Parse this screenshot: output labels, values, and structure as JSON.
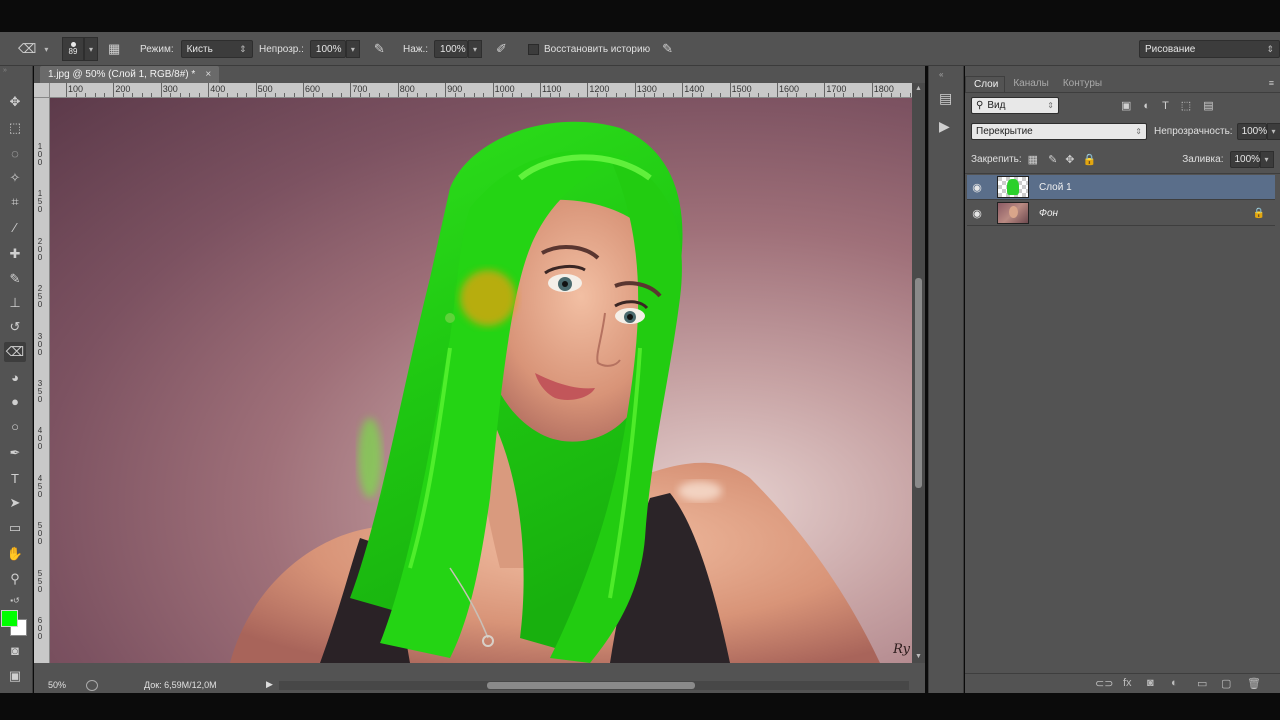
{
  "options_bar": {
    "brush_size": "89",
    "mode_label": "Режим:",
    "mode_value": "Кисть",
    "opacity_label": "Непрозр.:",
    "opacity_value": "100%",
    "pressure_label": "Наж.:",
    "pressure_value": "100%",
    "restore_history_label": "Восстановить историю",
    "workspace_value": "Рисование"
  },
  "document": {
    "tab_title": "1.jpg @ 50% (Слой 1, RGB/8#) *",
    "close_label": "×",
    "ruler_h": [
      "100",
      "200",
      "300",
      "400",
      "500",
      "600",
      "700",
      "800",
      "900",
      "1000",
      "1100",
      "1200",
      "1300",
      "1400",
      "1500",
      "1600",
      "1700",
      "1800"
    ],
    "ruler_v": [
      "1\n0\n0",
      "1\n5\n0",
      "2\n0\n0",
      "2\n5\n0",
      "3\n0\n0",
      "3\n5\n0",
      "4\n0\n0",
      "4\n5\n0",
      "5\n0\n0",
      "5\n5\n0",
      "6\n0\n0",
      "6\n5\n0"
    ],
    "zoom": "50%",
    "doc_info": "Док: 6,59M/12,0M",
    "signature": "Ry",
    "hair_color": "#22dd11",
    "hair_highlight": "#66ff33",
    "brush_spot_color": "#e8a010"
  },
  "toolbar": {
    "foreground_color": "#00ff00",
    "background_color": "#ffffff",
    "tools": [
      "move-tool",
      "marquee-tool",
      "lasso-tool",
      "quick-select-tool",
      "crop-tool",
      "eyedropper-tool",
      "healing-tool",
      "brush-tool",
      "clone-stamp-tool",
      "history-brush-tool",
      "eraser-tool",
      "paint-bucket-tool",
      "blur-tool",
      "dodge-tool",
      "pen-tool",
      "type-tool",
      "path-select-tool",
      "shape-tool",
      "hand-tool",
      "zoom-tool"
    ],
    "type_glyph": "T"
  },
  "layers_panel": {
    "tabs": [
      "Слои",
      "Каналы",
      "Контуры"
    ],
    "filter_value": "Вид",
    "blend_mode": "Перекрытие",
    "opacity_label": "Непрозрачность:",
    "opacity_value": "100%",
    "lock_label": "Закрепить:",
    "fill_label": "Заливка:",
    "fill_value": "100%",
    "filter_type_glyph": "T",
    "layers": [
      {
        "name": "Слой 1",
        "selected": true
      },
      {
        "name": "Фон",
        "selected": false,
        "locked": true
      }
    ]
  }
}
